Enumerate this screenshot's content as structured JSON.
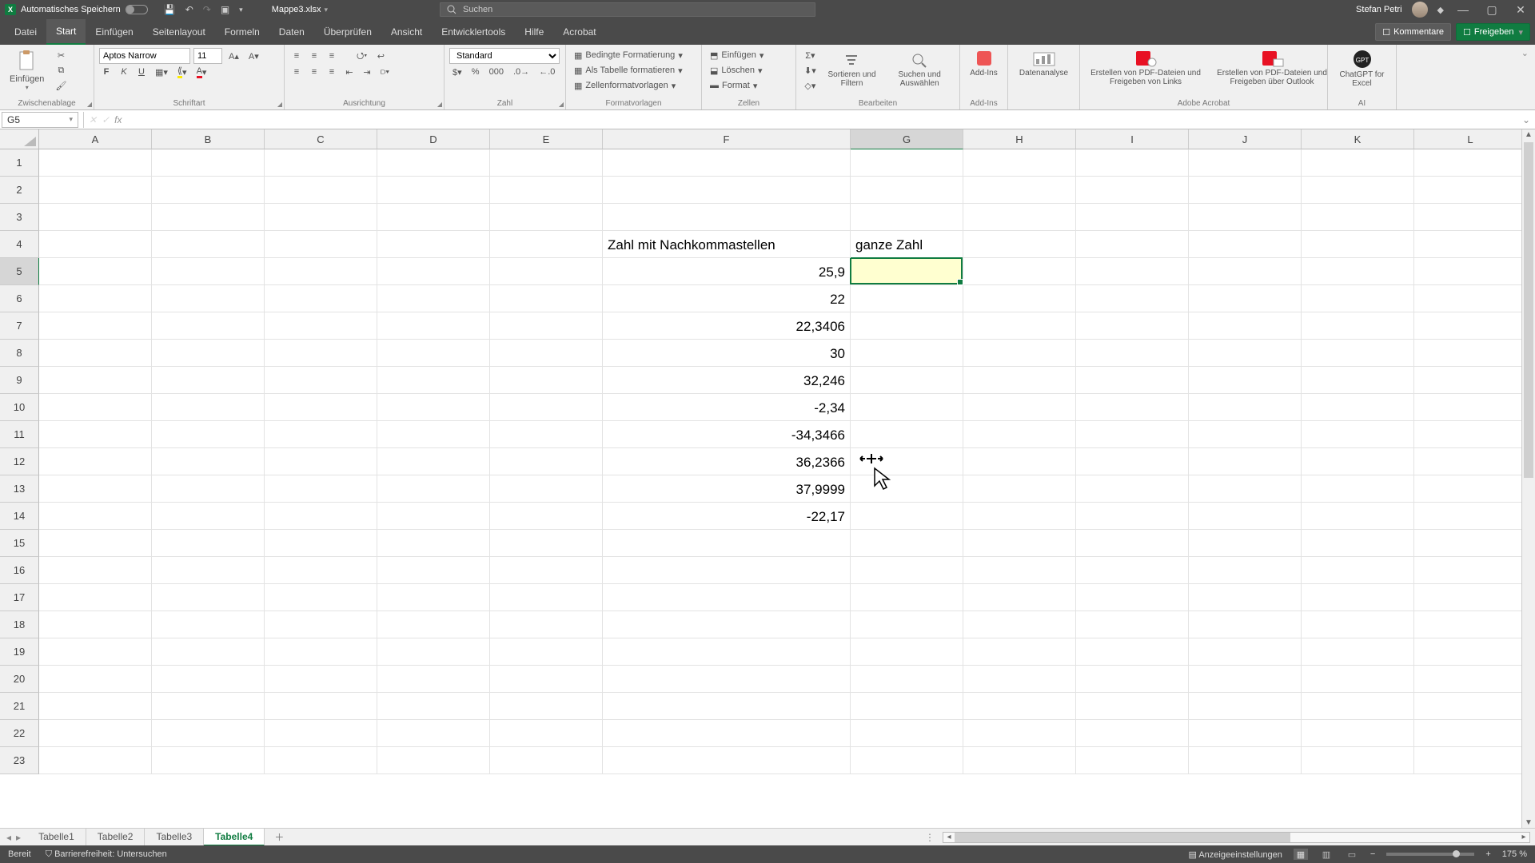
{
  "title": {
    "autosave_label": "Automatisches Speichern",
    "file_name": "Mappe3.xlsx",
    "search_placeholder": "Suchen",
    "user": "Stefan Petri"
  },
  "tabs": [
    "Datei",
    "Start",
    "Einfügen",
    "Seitenlayout",
    "Formeln",
    "Daten",
    "Überprüfen",
    "Ansicht",
    "Entwicklertools",
    "Hilfe",
    "Acrobat"
  ],
  "active_tab_index": 1,
  "ribbon_right": {
    "comments": "Kommentare",
    "share": "Freigeben"
  },
  "ribbon": {
    "clipboard": {
      "paste": "Einfügen",
      "title": "Zwischenablage"
    },
    "font": {
      "name": "Aptos Narrow",
      "size": "11",
      "title": "Schriftart"
    },
    "align": {
      "title": "Ausrichtung"
    },
    "number": {
      "format": "Standard",
      "title": "Zahl"
    },
    "styles": {
      "cond": "Bedingte Formatierung",
      "table": "Als Tabelle formatieren",
      "cell": "Zellenformatvorlagen",
      "title": "Formatvorlagen"
    },
    "cells": {
      "insert": "Einfügen",
      "delete": "Löschen",
      "format": "Format",
      "title": "Zellen"
    },
    "editing": {
      "sort": "Sortieren und Filtern",
      "find": "Suchen und Auswählen",
      "title": "Bearbeiten"
    },
    "addins": {
      "addins_btn": "Add-Ins",
      "analysis": "Datenanalyse",
      "title": "Add-Ins"
    },
    "acrobat": {
      "create": "Erstellen von PDF-Dateien und Freigeben von Links",
      "create2": "Erstellen von PDF-Dateien und Freigeben über Outlook",
      "title": "Adobe Acrobat"
    },
    "ai": {
      "btn": "ChatGPT for Excel",
      "title": "AI"
    }
  },
  "namebox": "G5",
  "formula": "",
  "columns": [
    "A",
    "B",
    "C",
    "D",
    "E",
    "F",
    "G",
    "H",
    "I",
    "J",
    "K",
    "L"
  ],
  "rows": 23,
  "selected": {
    "col": 6,
    "row": 5
  },
  "data": {
    "F4": "Zahl mit Nachkommastellen",
    "G4": "ganze Zahl",
    "F5": "25,9",
    "F6": "22",
    "F7": "22,3406",
    "F8": "30",
    "F9": "32,246",
    "F10": "-2,34",
    "F11": "-34,3466",
    "F12": "36,2366",
    "F13": "37,9999",
    "F14": "-22,17"
  },
  "sheet_tabs": [
    "Tabelle1",
    "Tabelle2",
    "Tabelle3",
    "Tabelle4"
  ],
  "active_sheet": 3,
  "status": {
    "ready": "Bereit",
    "access": "Barrierefreiheit: Untersuchen",
    "display": "Anzeigeeinstellungen",
    "zoom": "175 %"
  }
}
